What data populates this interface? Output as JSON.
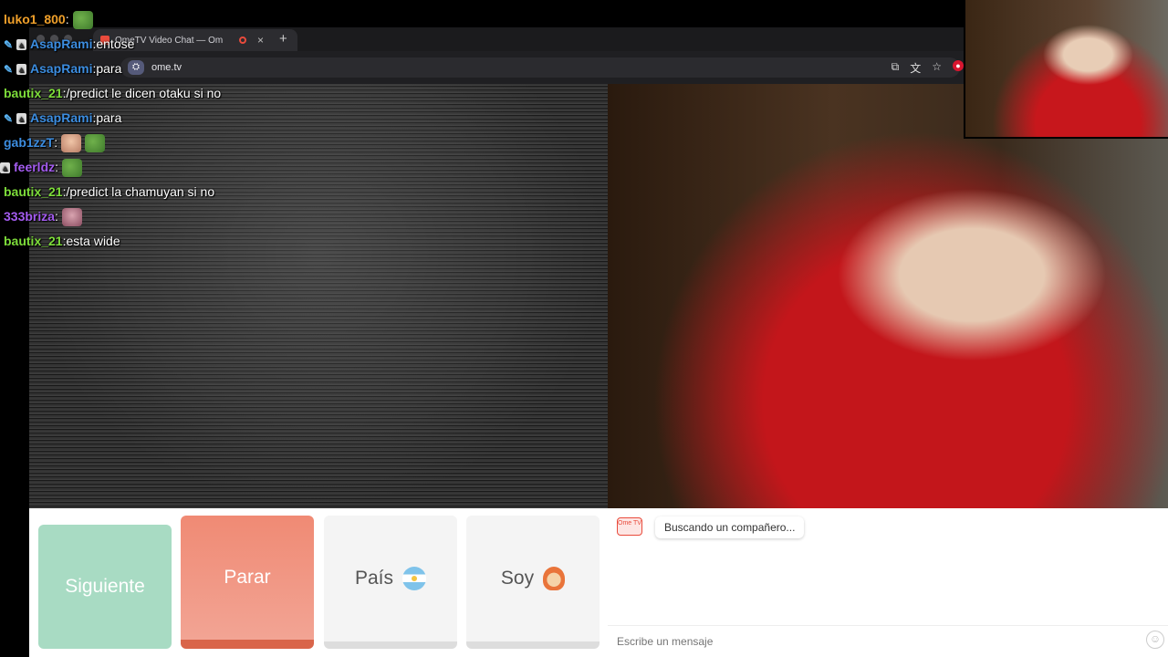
{
  "browser": {
    "tab_title": "OmeTV Video Chat — Om",
    "tab_close": "×",
    "new_tab": "+",
    "url": "ome.tv"
  },
  "stream_chat": [
    {
      "badges": [],
      "user": "luko1_800",
      "user_color": "#f0a02a",
      "msg": "",
      "emotes": [
        "pepe"
      ]
    },
    {
      "badges": [
        "mod",
        "sub"
      ],
      "user": "AsapRami",
      "user_color": "#3c8de0",
      "msg": "entose",
      "emotes": []
    },
    {
      "badges": [
        "mod",
        "sub"
      ],
      "user": "AsapRami",
      "user_color": "#3c8de0",
      "msg": "para",
      "emotes": []
    },
    {
      "badges": [],
      "user": "bautix_21",
      "user_color": "#7ddc3a",
      "msg": "/predict le dicen otaku si no",
      "emotes": []
    },
    {
      "badges": [
        "mod",
        "sub"
      ],
      "user": "AsapRami",
      "user_color": "#3c8de0",
      "msg": "para",
      "emotes": []
    },
    {
      "badges": [],
      "user": "gab1zzT",
      "user_color": "#3c8de0",
      "msg": "",
      "emotes": [
        "face",
        "pepe"
      ]
    },
    {
      "badges": [
        "sub"
      ],
      "user": "feerldz",
      "user_color": "#a45cf0",
      "msg": "",
      "emotes": [
        "pepe"
      ]
    },
    {
      "badges": [],
      "user": "bautix_21",
      "user_color": "#7ddc3a",
      "msg": "/predict la chamuyan si no",
      "emotes": []
    },
    {
      "badges": [],
      "user": "333briza",
      "user_color": "#a45cf0",
      "msg": "",
      "emotes": [
        "face2"
      ]
    },
    {
      "badges": [],
      "user": "bautix_21",
      "user_color": "#7ddc3a",
      "msg": "esta wide",
      "emotes": []
    }
  ],
  "controls": {
    "siguiente": "Siguiente",
    "parar": "Parar",
    "pais": "País",
    "soy": "Soy"
  },
  "chat": {
    "logo_text": "Ome TV",
    "status": "Buscando un compañero...",
    "input_placeholder": "Escribe un mensaje"
  }
}
